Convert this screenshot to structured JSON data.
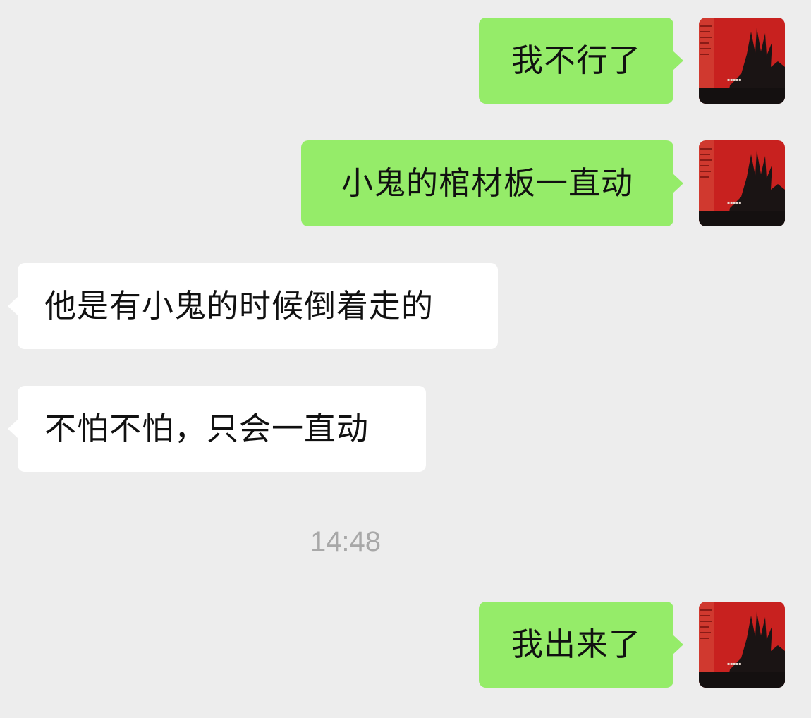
{
  "chat": {
    "messages": [
      {
        "side": "outgoing",
        "text": "我不行了"
      },
      {
        "side": "outgoing",
        "text": "小鬼的棺材板一直动"
      },
      {
        "side": "incoming",
        "text": "他是有小鬼的时候倒着走的"
      },
      {
        "side": "incoming",
        "text": "不怕不怕，只会一直动"
      },
      {
        "side": "outgoing",
        "text": "我出来了"
      }
    ],
    "timestamp": "14:48"
  },
  "theme": {
    "background": "#ededed",
    "outgoing_bubble": "#95ec69",
    "incoming_bubble": "#ffffff",
    "timestamp_color": "#a8a8a8",
    "avatar_colors": [
      "#c8211f",
      "#1a1414"
    ]
  },
  "icons": {
    "avatar": "red-hand-silhouette-avatar-icon"
  }
}
